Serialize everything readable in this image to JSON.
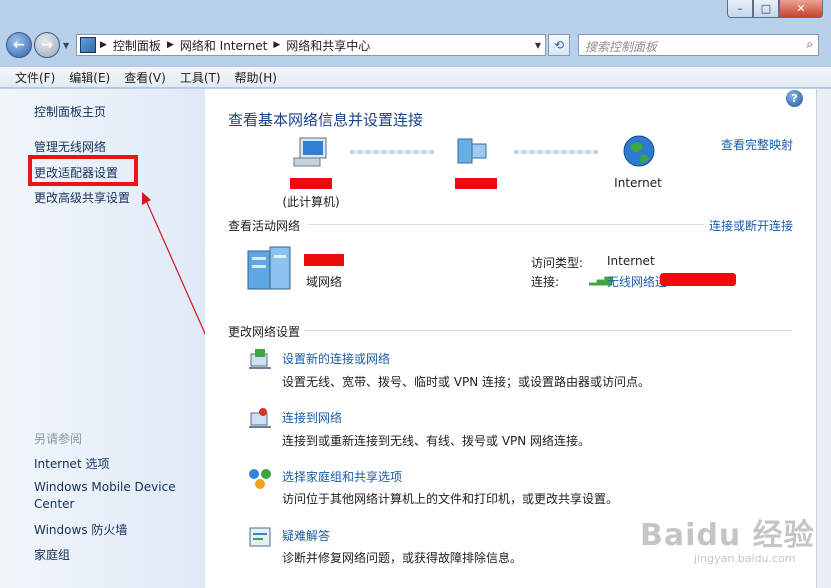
{
  "window": {
    "min_label": "–",
    "max_label": "□",
    "close_label": "✕"
  },
  "address": {
    "crumbs": [
      "控制面板",
      "网络和 Internet",
      "网络和共享中心"
    ]
  },
  "search": {
    "placeholder": "搜索控制面板"
  },
  "menubar": [
    "文件(F)",
    "编辑(E)",
    "查看(V)",
    "工具(T)",
    "帮助(H)"
  ],
  "sidebar": {
    "items": [
      "控制面板主页",
      "管理无线网络",
      "更改适配器设置",
      "更改高级共享设置"
    ],
    "see_also_label": "另请参阅",
    "see_also": [
      "Internet 选项",
      "Windows Mobile Device Center",
      "Windows 防火墙",
      "家庭组"
    ]
  },
  "main": {
    "title": "查看基本网络信息并设置连接",
    "view_full_map": "查看完整映射",
    "map": {
      "this_computer": "(此计算机)",
      "internet": "Internet"
    },
    "active_header": "查看活动网络",
    "connect_disconnect": "连接或断开连接",
    "network_type": "域网络",
    "access_type_label": "访问类型:",
    "access_type_value": "Internet",
    "connection_label": "连接:",
    "connection_value": "无线网络连",
    "change_header": "更改网络设置",
    "tasks": [
      {
        "title": "设置新的连接或网络",
        "desc": "设置无线、宽带、拨号、临时或 VPN 连接；或设置路由器或访问点。"
      },
      {
        "title": "连接到网络",
        "desc": "连接到或重新连接到无线、有线、拨号或 VPN 网络连接。"
      },
      {
        "title": "选择家庭组和共享选项",
        "desc": "访问位于其他网络计算机上的文件和打印机，或更改共享设置。"
      },
      {
        "title": "疑难解答",
        "desc": "诊断并修复网络问题，或获得故障排除信息。"
      }
    ]
  },
  "watermark": {
    "brand": "Baidu 经验",
    "url": "jingyan.baidu.com"
  },
  "colors": {
    "highlight": "#e8141a",
    "link": "#1c5ba8",
    "title": "#1c3f8a",
    "redaction": "#ef0a0e"
  }
}
